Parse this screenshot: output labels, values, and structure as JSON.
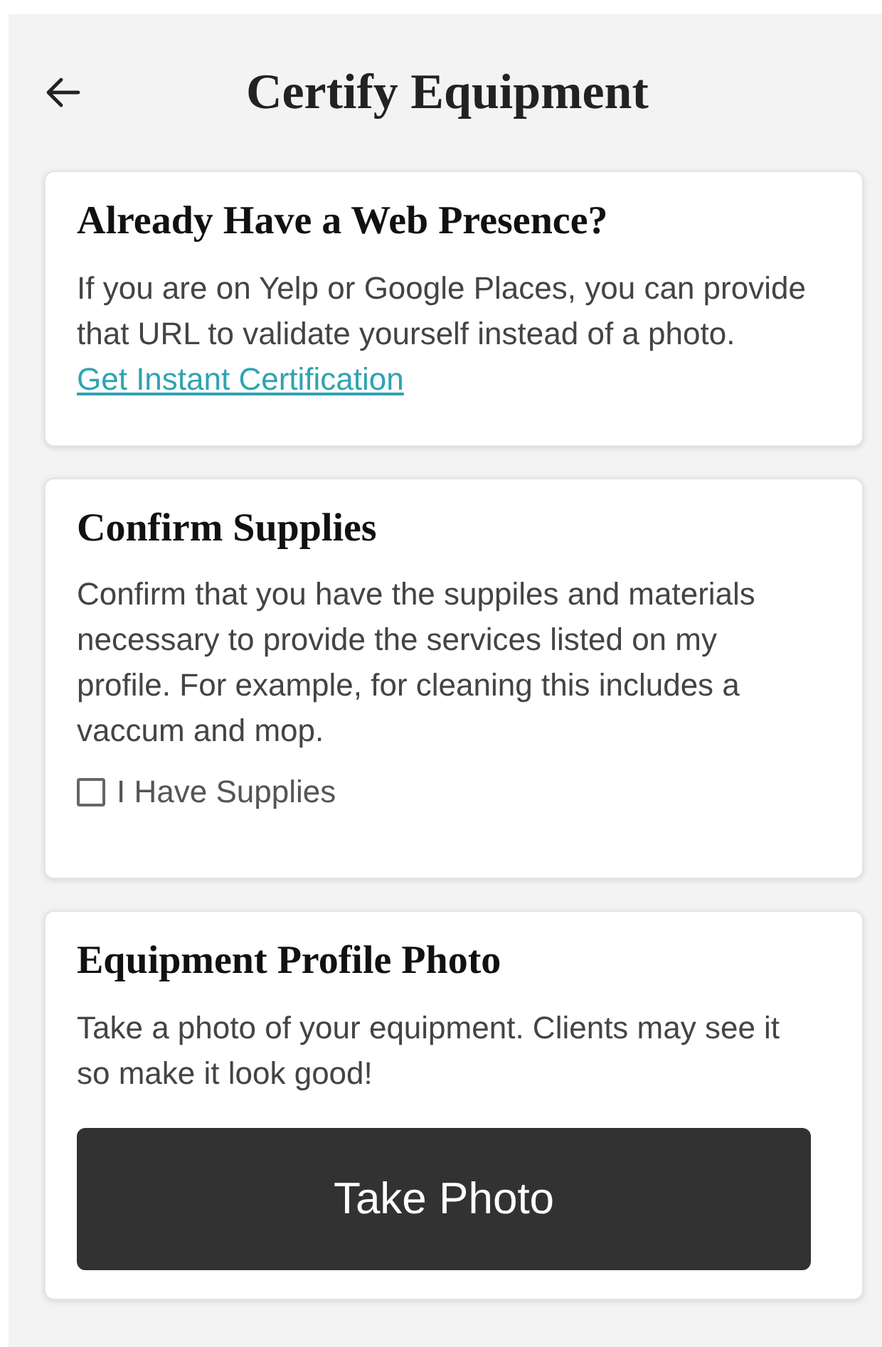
{
  "header": {
    "title": "Certify Equipment"
  },
  "cards": [
    {
      "kind": "link",
      "title": "Already Have a Web Presence?",
      "text": "If you are on Yelp or Google Places, you can provide that URL to validate yourself instead of a photo.",
      "link": "Get Instant Certification"
    },
    {
      "kind": "checkbox",
      "title": "Confirm Supplies",
      "text": "Confirm that you have the suppiles and materials necessary to provide the services listed on my profile. For example, for cleaning this includes a vaccum and mop.",
      "checkbox": {
        "label": "I Have Supplies",
        "checked": false
      }
    },
    {
      "kind": "button",
      "title": "Equipment Profile Photo",
      "text": "Take a photo of your equipment. Clients may see it so make it look good!",
      "button": "Take Photo"
    }
  ]
}
